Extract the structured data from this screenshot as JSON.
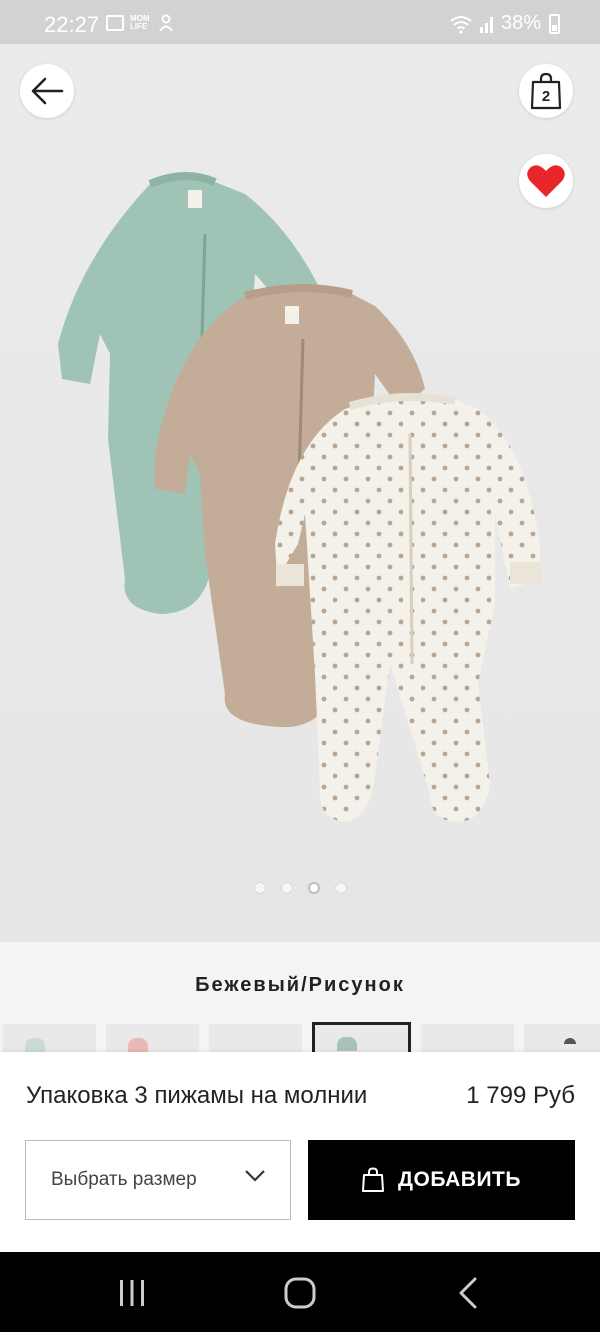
{
  "status_bar": {
    "time": "22:27",
    "notif_text": "MOM LIFE",
    "battery": "38%",
    "icons": [
      "gallery-icon",
      "mom-life-icon",
      "baby-icon",
      "wifi-icon",
      "signal-icon",
      "battery-icon"
    ]
  },
  "product_image": {
    "alt": "3 baby pajamas on zipper",
    "garments": [
      "mint",
      "beige",
      "white-dotted"
    ],
    "pager_total": 4,
    "pager_active": 3
  },
  "header": {
    "cart_count": "2",
    "back_icon": "arrow-left-icon",
    "bag_icon": "shopping-bag-icon",
    "favorite_icon": "heart-icon"
  },
  "color": {
    "name": "Бежевый/Рисунок",
    "swatches": [
      "mint",
      "pink",
      "light",
      "mint-selected",
      "light",
      "dark"
    ]
  },
  "product": {
    "name": "Упаковка 3 пижамы на молнии",
    "price": "1 799 Руб"
  },
  "actions": {
    "size_placeholder": "Выбрать размер",
    "add_label": "ДОБАВИТЬ"
  },
  "colors": {
    "heart": "#e8262a",
    "primary_button": "#000000",
    "mint": "#9fc4b6",
    "beige": "#c3ad98",
    "cream": "#f4f1ea"
  }
}
